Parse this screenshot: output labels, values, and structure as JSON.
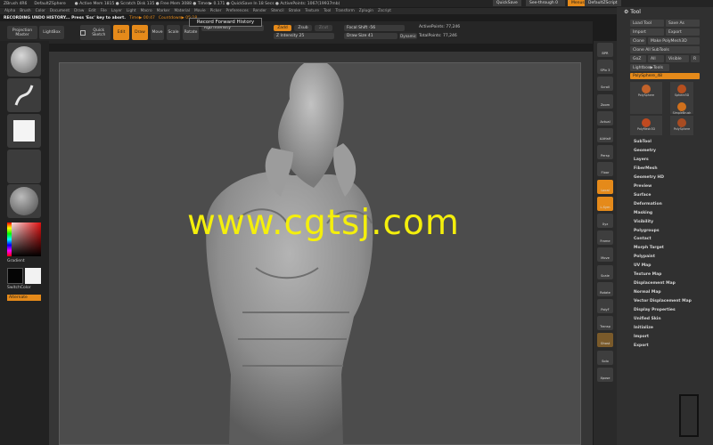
{
  "title_bar": {
    "app": "ZBrush 4R6",
    "document": "DefaultZSphere",
    "stats": "● Active Mem 1815 ● Scratch Disk 135 ● Free Mem 3088 ● Timer▶ 0.171 ● QuickSave In 18 Secs ● ActivePoints: 1067(19937mb)",
    "quicksave": "QuickSave",
    "see_through": "See-through  0",
    "menus_btn": "Menus",
    "script": "DefaultZScript"
  },
  "menus": [
    "Alpha",
    "Brush",
    "Color",
    "Document",
    "Draw",
    "Edit",
    "File",
    "Layer",
    "Light",
    "Macro",
    "Marker",
    "Material",
    "Movie",
    "Picker",
    "Preferences",
    "Render",
    "Stencil",
    "Stroke",
    "Texture",
    "Tool",
    "Transform",
    "Zplugin",
    "Zscript"
  ],
  "recording": {
    "message": "RECORDING UNDO HISTORY...  Press 'Esc' key to abort.",
    "time": "Time▶ 00:47",
    "countdown": "Countdown▶ 05:18"
  },
  "shelf": {
    "projection_master": "Projection Master",
    "lightbox": "LightBox",
    "quick_sketch": "Quick Sketch",
    "edit": "Edit",
    "draw": "Draw",
    "move": "Move",
    "scale": "Scale",
    "rotate": "Rotate",
    "tooltip": "Record Forward History",
    "rgb_intensity": "Rgb Intensity",
    "zadd": "Zadd",
    "zsub": "Zsub",
    "zcut": "Zcut",
    "z_intensity": "Z Intensity 25",
    "focal_shift": "Focal Shift -56",
    "draw_size": "Draw Size 41",
    "dynamic": "Dynamic",
    "active_points": "ActivePoints: 77,246",
    "total_points": "TotalPoints: 77,246"
  },
  "left_tray": {
    "gradient": "Gradient",
    "switch_color": "SwitchColor",
    "alternate": "Alternate"
  },
  "right_shelf": [
    "BPR",
    "SPix 3",
    "Scroll",
    "Zoom",
    "Actual",
    "AAHalf",
    "Persp",
    "Floor",
    "Local",
    "L.Sym",
    "Xyz",
    "Frame",
    "Move",
    "Scale",
    "Rotate",
    "PolyF",
    "Transp",
    "Ghost",
    "Solo",
    "Xpose"
  ],
  "tool_palette": {
    "header": "Tool",
    "load_tool": "Load Tool",
    "save_as": "Save As",
    "import": "Import",
    "export": "Export",
    "clone": "Clone",
    "make_polymesh": "Make PolyMesh3D",
    "clone_all": "Clone All SubTools",
    "goz": "GoZ",
    "all": "All",
    "visible": "Visible",
    "r": "R",
    "lightbox_tools": "Lightbox▶Tools",
    "current_tool": "PolySphere_48",
    "tool_thumbs": [
      {
        "label": "PolySphere",
        "color": "#c2622a"
      },
      {
        "label": "Sphere3D",
        "color": "#b64f1e"
      },
      {
        "label": "SimpleBrush",
        "color": "#d0701c"
      },
      {
        "label": "PolyMesh3D",
        "color": "#c04a20"
      },
      {
        "label": "PolySphere",
        "color": "#a84c22"
      }
    ],
    "sections": [
      "SubTool",
      "Geometry",
      "Layers",
      "FiberMesh",
      "Geometry HD",
      "Preview",
      "Surface",
      "Deformation",
      "Masking",
      "Visibility",
      "Polygroups",
      "Contact",
      "Morph Target",
      "Polypaint",
      "UV Map",
      "Texture Map",
      "Displacement Map",
      "Normal Map",
      "Vector Displacement Map",
      "Display Properties",
      "Unified Skin",
      "Initialize",
      "Import",
      "Export"
    ]
  },
  "watermark": "www.cgtsj.com",
  "colors": {
    "accent": "#e58a1a",
    "watermark": "#f4ef0c",
    "model": "#9a9a9a"
  }
}
